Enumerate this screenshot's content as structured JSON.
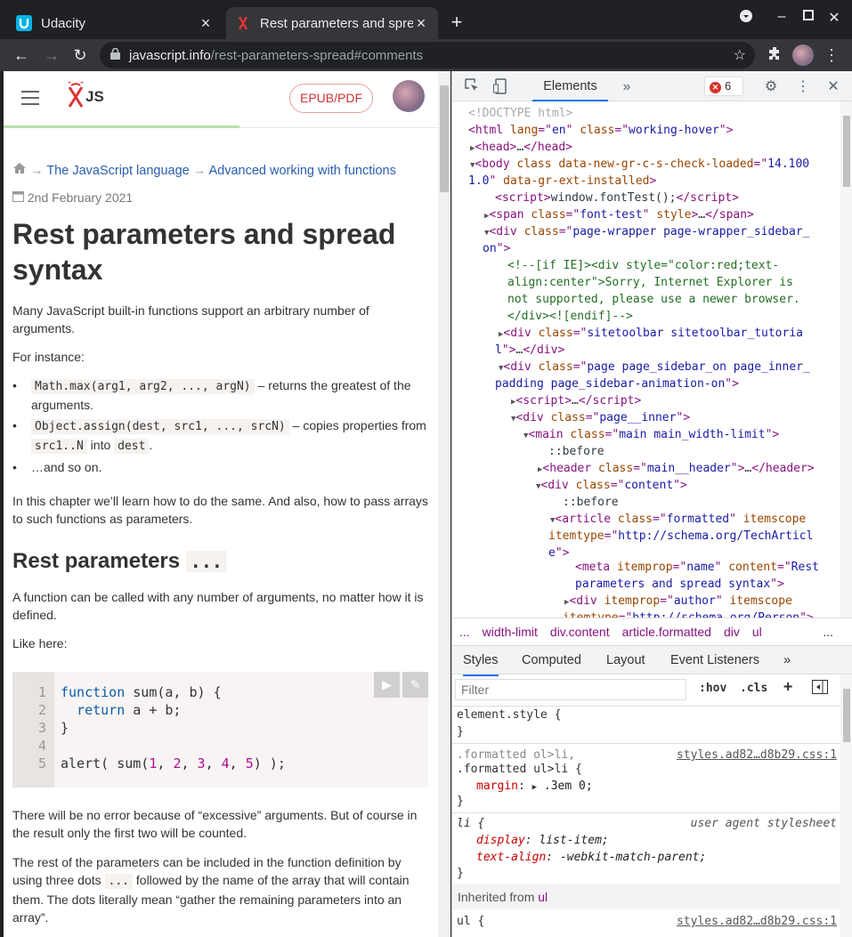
{
  "browser": {
    "tabs": [
      {
        "title": "Udacity",
        "icon": "udacity-icon"
      },
      {
        "title": "Rest parameters and spre",
        "icon": "javascript-info-icon",
        "active": true
      }
    ],
    "url_host": "javascript.info",
    "url_path": "/rest-parameters-spread#comments"
  },
  "page": {
    "logo_text": "JS",
    "epub_label": "EPUB/PDF",
    "breadcrumbs": [
      "The JavaScript language",
      "Advanced working with functions"
    ],
    "breadcrumb_sep": "→",
    "date": "2nd February 2021",
    "title": "Rest parameters and spread syntax",
    "intro": "Many JavaScript built-in functions support an arbitrary number of arguments.",
    "for_instance": "For instance:",
    "list": [
      {
        "code": "Math.max(arg1, arg2, ..., argN)",
        "text": " – returns the greatest of the arguments."
      },
      {
        "code": "Object.assign(dest, src1, ..., srcN)",
        "text": " – copies properties from ",
        "code2": "src1..N",
        "text2": " into ",
        "code3": "dest",
        "text3": "."
      },
      {
        "text": "…and so on."
      }
    ],
    "chapter_note": "In this chapter we’ll learn how to do the same. And also, how to pass arrays to such functions as parameters.",
    "h2": "Rest parameters",
    "h2_code": "...",
    "called_text": "A function can be called with any number of arguments, no matter how it is defined.",
    "like_here": "Like here:",
    "code_lines": [
      "1",
      "2",
      "3",
      "4",
      "5"
    ],
    "no_error": "There will be no error because of “excessive” arguments. But of course in the result only the first two will be counted.",
    "rest_p1": "The rest of the parameters can be included in the function definition by using three dots ",
    "rest_code": "...",
    "rest_p2": " followed by the name of the array that will contain them. The dots literally mean “gather the remaining parameters into an array”."
  },
  "devtools": {
    "tab_elements": "Elements",
    "error_count": "6",
    "breadcrumb": [
      "...",
      "width-limit",
      "div.content",
      "article.formatted",
      "div",
      "ul",
      "..."
    ],
    "styles_tabs": [
      "Styles",
      "Computed",
      "Layout",
      "Event Listeners",
      "»"
    ],
    "filter_placeholder": "Filter",
    "hov": ":hov",
    "cls": ".cls",
    "rules": {
      "element_style": "element.style {",
      "close": "}",
      "sel1a": ".formatted ol>li,",
      "sel1b": ".formatted ul>li {",
      "src1": "styles.ad82…d8b29.css:1",
      "margin_name": "margin",
      "margin_val": ".3em 0;",
      "sel2": "li {",
      "src2": "user agent stylesheet",
      "display_name": "display",
      "display_val": "list-item;",
      "ta_name": "text-align",
      "ta_val": "-webkit-match-parent;",
      "inherited_label": "Inherited from ",
      "inherited_el": "ul",
      "sel3": "ul {",
      "src3": "styles.ad82…d8b29.css:1"
    }
  }
}
